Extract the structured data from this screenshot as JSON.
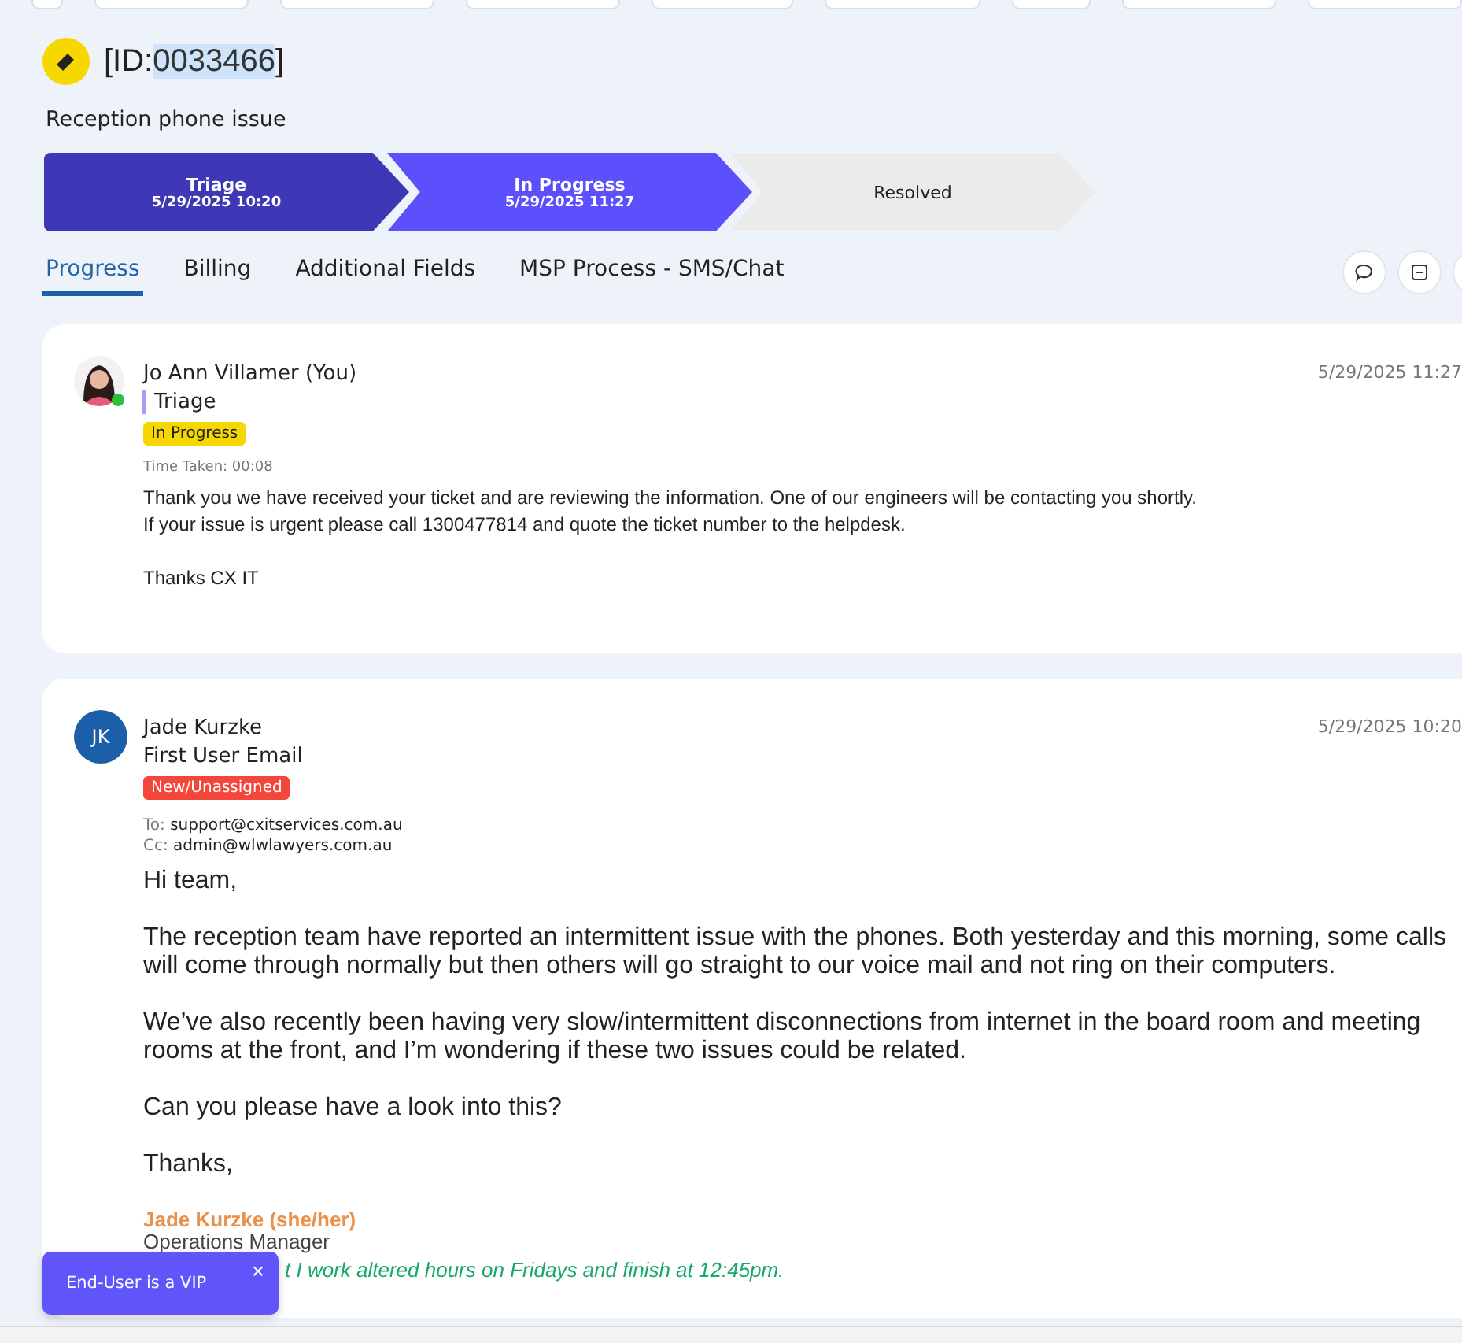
{
  "ticket": {
    "id_prefix": "[ID:",
    "id_number": "0033466",
    "id_suffix": "]",
    "id_highlighted": true,
    "subject": "Reception phone issue"
  },
  "stages": [
    {
      "name": "Triage",
      "date": "5/29/2025 10:20",
      "selected": false
    },
    {
      "name": "In Progress",
      "date": "5/29/2025 11:27",
      "selected": true
    },
    {
      "name": "Resolved",
      "selected": false
    }
  ],
  "tabs": [
    {
      "label": "Progress",
      "selected": true
    },
    {
      "label": "Billing",
      "selected": false
    },
    {
      "label": "Additional Fields",
      "selected": false
    },
    {
      "label": "MSP Process - SMS/Chat",
      "selected": false
    }
  ],
  "posts": [
    {
      "kind": "note",
      "author": "Jo Ann Villamer (You)",
      "online": true,
      "stage": "Triage",
      "status": "In Progress",
      "color": "#f7d700",
      "time": "5/29/2025 11:27",
      "time_taken_label": "Time Taken:",
      "time_taken": "00:08",
      "body": [
        [
          "Thank you we have received your ticket and are reviewing the information. One of our engineers will be contacting you shortly.",
          "If your issue is urgent please call 1300477814 and quote the ticket number to the helpdesk."
        ],
        [
          "Thanks CX IT"
        ]
      ]
    },
    {
      "kind": "email",
      "author": "Jade Kurzke",
      "initials": "JK",
      "stage": "First User Email",
      "status": "New/Unassigned",
      "color": "#f2473a",
      "time": "5/29/2025 10:20",
      "to_label": "To:",
      "to": "support@cxitservices.com.au",
      "cc_label": "Cc:",
      "cc": "admin@wlwlawyers.com.au",
      "body": [
        "Hi team,",
        "The reception team have reported an intermittent issue with the phones. Both yesterday and this morning, some calls will come through normally but then others will go straight to our voice mail and not ring on their computers.",
        "We’ve also recently been having very slow/intermittent disconnections from internet in the board room and meeting rooms at the front, and I’m wondering if these two issues could be related.",
        "Can you please have a look into this?",
        "Thanks,"
      ],
      "signature_name": "Jade Kurzke (she/her)",
      "signature_title": "Operations Manager",
      "signature_note": "t I work altered hours on Fridays and finish at 12:45pm."
    }
  ],
  "toast": {
    "message": "End-User is a VIP",
    "close": "×"
  }
}
